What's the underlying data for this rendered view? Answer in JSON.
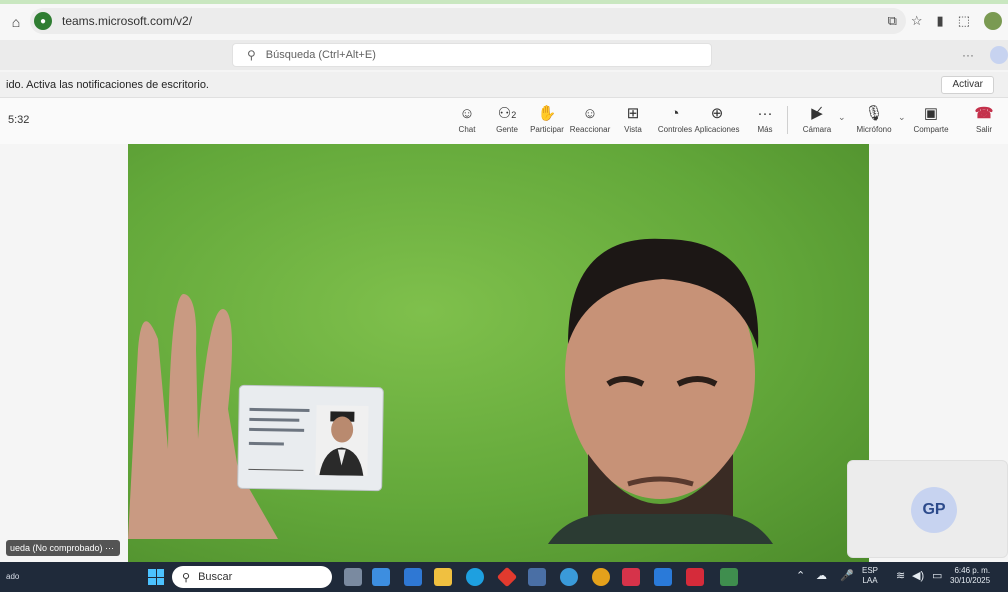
{
  "browser": {
    "url": "teams.microsoft.com/v2/",
    "home_icon": "home-icon",
    "site_icon": "teams-site-icon"
  },
  "teams": {
    "search_placeholder": "Búsqueda (Ctrl+Alt+E)",
    "more_label": "···"
  },
  "notification": {
    "message": "ido. Activa las notificaciones de escritorio.",
    "activate_label": "Activar"
  },
  "meeting": {
    "elapsed_time": "5:32",
    "participants_count": "2",
    "toolbar": {
      "chat": "Chat",
      "people": "Gente",
      "raise": "Participar",
      "react": "Reaccionar",
      "view": "Vista",
      "controls": "Controles",
      "apps": "Aplicaciones",
      "more": "Más",
      "camera": "Cámara",
      "mic": "Micrófono",
      "share": "Comparte",
      "leave": "Salir"
    }
  },
  "stage": {
    "participant_label": "ueda (No comprobado)  ···",
    "self_initials": "GP"
  },
  "taskbar": {
    "left_text": "ado",
    "search_label": "Buscar",
    "lang_line1": "ESP",
    "lang_line2": "LAA",
    "time": "6:46 p. m.",
    "date": "30/10/2025"
  },
  "colors": {
    "accent": "#5b5fc7",
    "leave_red": "#c4314b",
    "video_green": "#63a83a",
    "taskbar": "#1f2a3a"
  }
}
